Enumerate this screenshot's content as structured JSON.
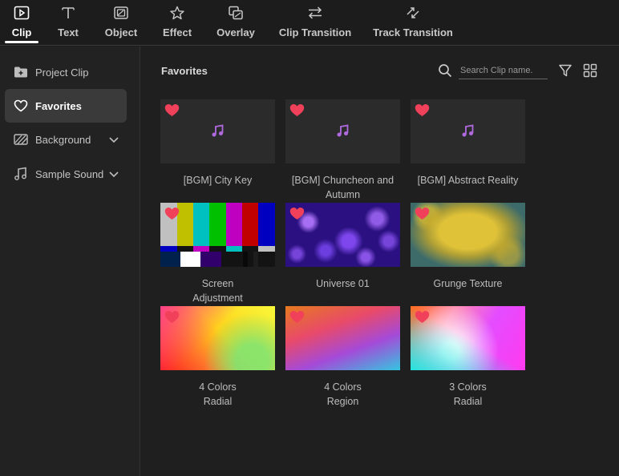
{
  "tabs": [
    {
      "label": "Clip",
      "icon": "clip-icon",
      "active": true
    },
    {
      "label": "Text",
      "icon": "text-icon",
      "active": false
    },
    {
      "label": "Object",
      "icon": "object-icon",
      "active": false
    },
    {
      "label": "Effect",
      "icon": "effect-icon",
      "active": false
    },
    {
      "label": "Overlay",
      "icon": "overlay-icon",
      "active": false
    },
    {
      "label": "Clip Transition",
      "icon": "clip-transition-icon",
      "active": false
    },
    {
      "label": "Track Transition",
      "icon": "track-transition-icon",
      "active": false
    }
  ],
  "sidebar": {
    "items": [
      {
        "label": "Project Clip",
        "icon": "folder-plus-icon",
        "active": false,
        "expandable": false
      },
      {
        "label": "Favorites",
        "icon": "heart-outline-icon",
        "active": true,
        "expandable": false
      },
      {
        "label": "Background",
        "icon": "hatch-icon",
        "active": false,
        "expandable": true
      },
      {
        "label": "Sample Sound",
        "icon": "music-note-icon",
        "active": false,
        "expandable": true
      }
    ]
  },
  "main": {
    "title": "Favorites",
    "search_placeholder": "Search Clip name.",
    "search_value": "",
    "items": [
      {
        "name": "[BGM] City Key",
        "caption_lines": [
          "[BGM] City Key"
        ],
        "kind": "audio",
        "favorite": true
      },
      {
        "name": "[BGM] Chuncheon and Autumn",
        "caption_lines": [
          "[BGM] Chuncheon and",
          "Autumn"
        ],
        "kind": "audio",
        "favorite": true
      },
      {
        "name": "[BGM] Abstract Reality",
        "caption_lines": [
          "[BGM] Abstract Reality"
        ],
        "kind": "audio",
        "favorite": true
      },
      {
        "name": "Screen Adjustment",
        "caption_lines": [
          "Screen",
          "Adjustment"
        ],
        "kind": "color-bars",
        "favorite": true
      },
      {
        "name": "Universe 01",
        "caption_lines": [
          "Universe 01"
        ],
        "kind": "universe",
        "favorite": true
      },
      {
        "name": "Grunge Texture",
        "caption_lines": [
          "Grunge Texture"
        ],
        "kind": "grunge",
        "favorite": true
      },
      {
        "name": "4 Colors Radial",
        "caption_lines": [
          "4 Colors",
          "Radial"
        ],
        "kind": "gradient-4-radial",
        "favorite": true
      },
      {
        "name": "4 Colors Region",
        "caption_lines": [
          "4 Colors",
          "Region"
        ],
        "kind": "gradient-4-region",
        "favorite": true
      },
      {
        "name": "3 Colors Radial",
        "caption_lines": [
          "3 Colors",
          "Radial"
        ],
        "kind": "gradient-3-radial",
        "favorite": true
      }
    ]
  },
  "colors": {
    "favorite_heart": "#f0405a",
    "music_note": "#b06ae0",
    "active_tab_underline": "#ffffff",
    "active_sidebar_bg": "#3a3a3a"
  }
}
